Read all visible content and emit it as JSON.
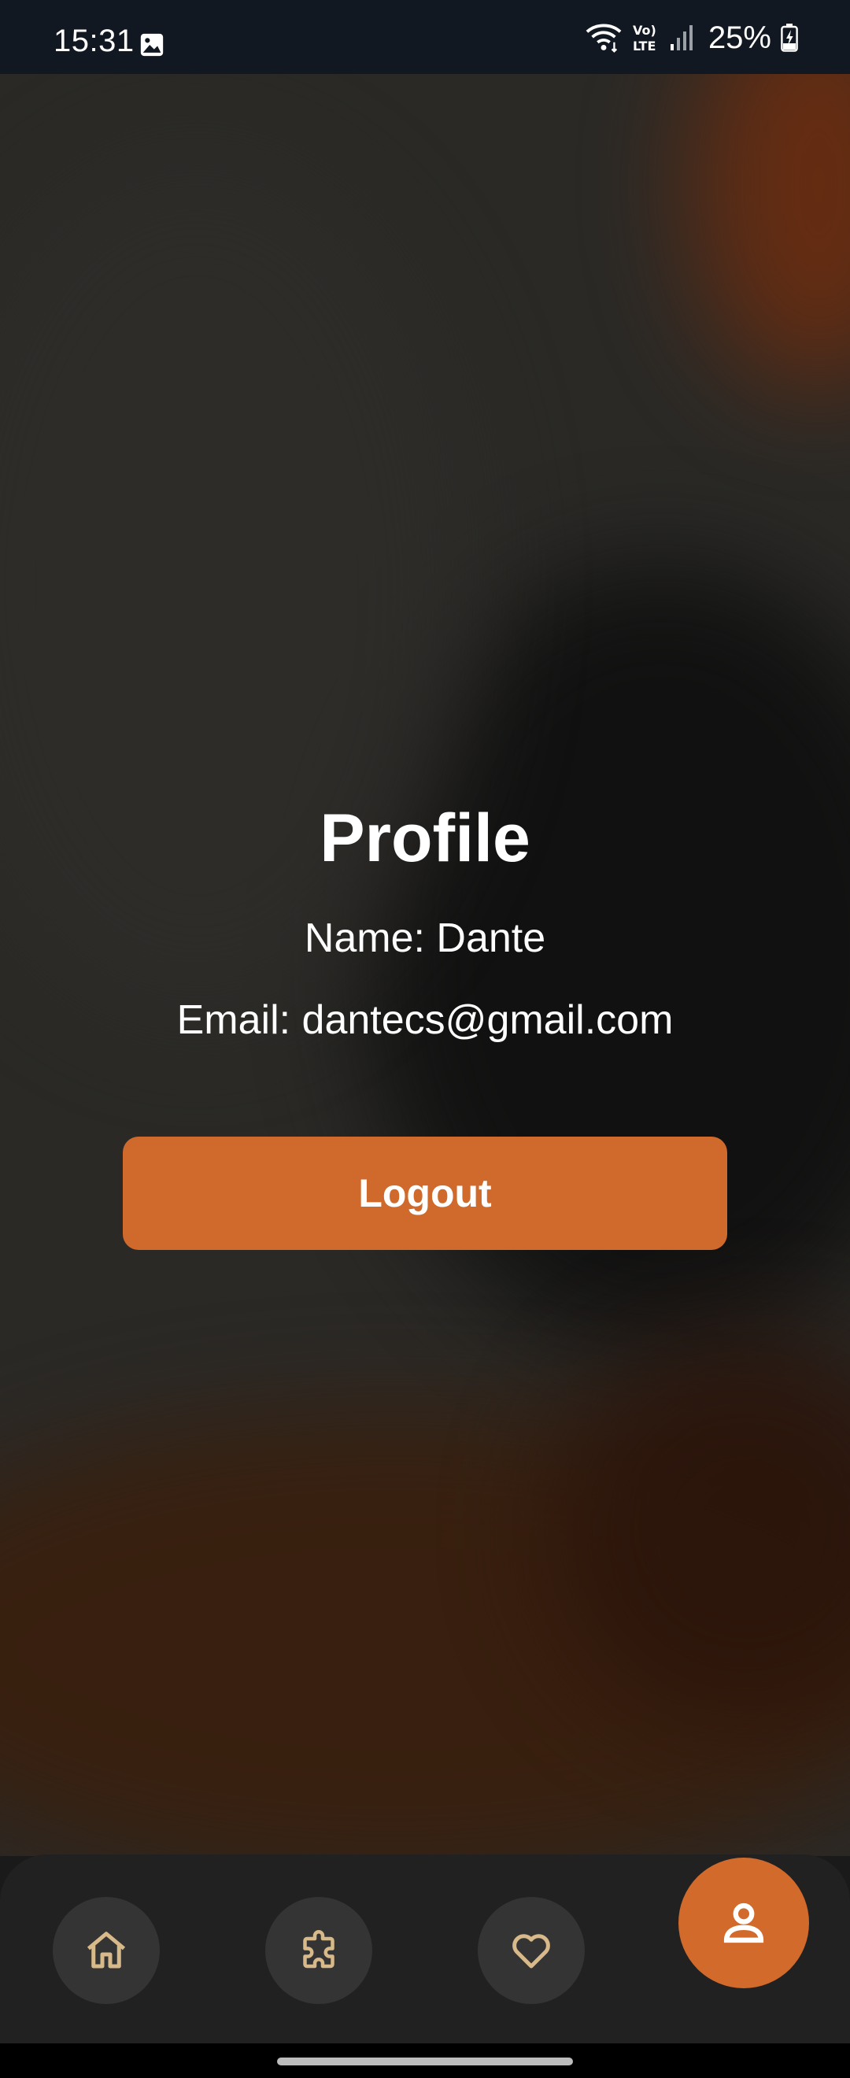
{
  "status_bar": {
    "time": "15:31",
    "battery": "25%",
    "icons": [
      "gallery-icon",
      "wifi-icon",
      "volte-icon",
      "signal-icon",
      "battery-charging-icon"
    ],
    "volte_label": "LTE"
  },
  "profile": {
    "title": "Profile",
    "name_line": "Name: Dante",
    "email_line": "Email: dantecs@gmail.com"
  },
  "logout_button": {
    "label": "Logout",
    "color": "#cf6a2c"
  },
  "bottom_nav": {
    "items": [
      {
        "icon": "home-icon",
        "active": false
      },
      {
        "icon": "puzzle-icon",
        "active": false
      },
      {
        "icon": "heart-icon",
        "active": false
      },
      {
        "icon": "person-icon",
        "active": true
      }
    ],
    "icon_color": "#d8b98a",
    "active_color": "#d16a2b"
  }
}
